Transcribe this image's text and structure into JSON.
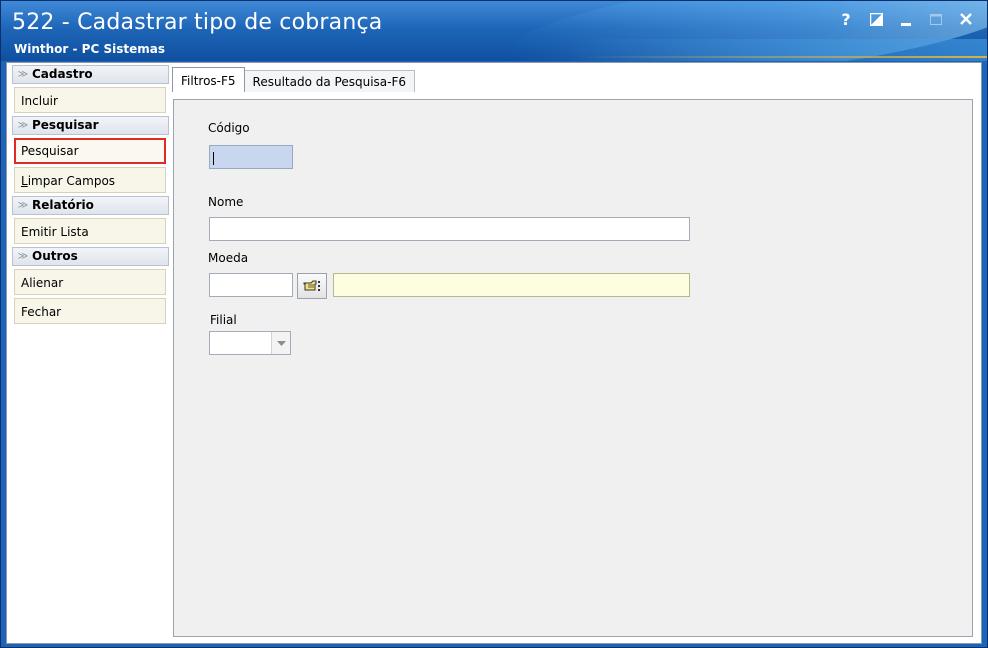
{
  "window": {
    "title": "522 - Cadastrar tipo de cobrança",
    "subtitle": "Winthor - PC Sistemas",
    "help_label": "?"
  },
  "sidebar": {
    "groups": [
      {
        "title": "Cadastro",
        "items": [
          {
            "label": "Incluir"
          }
        ]
      },
      {
        "title": "Pesquisar",
        "items": [
          {
            "label": "Pesquisar"
          },
          {
            "label_underlined": "L",
            "label_rest": "impar Campos"
          }
        ]
      },
      {
        "title": "Relatório",
        "items": [
          {
            "label": "Emitir Lista"
          }
        ]
      },
      {
        "title": "Outros",
        "items": [
          {
            "label": "Alienar"
          },
          {
            "label": "Fechar"
          }
        ]
      }
    ]
  },
  "tabs": [
    {
      "label": "Filtros-F5",
      "active": true
    },
    {
      "label": "Resultado da Pesquisa-F6",
      "active": false
    }
  ],
  "form": {
    "codigo_label": "Código",
    "codigo_value": "",
    "nome_label": "Nome",
    "nome_value": "",
    "moeda_label": "Moeda",
    "moeda_code_value": "",
    "moeda_desc_value": "",
    "filial_label": "Filial",
    "filial_value": ""
  },
  "colors": {
    "accent_border_selected": "#e02a2a",
    "title_bar": "#1f66b8",
    "codigo_field": "#c9d6ef",
    "readonly_field": "#fdfde0"
  },
  "icons": {
    "lookup": "pointing-hand-icon",
    "group_chevron": "double-chevron-down-icon"
  }
}
